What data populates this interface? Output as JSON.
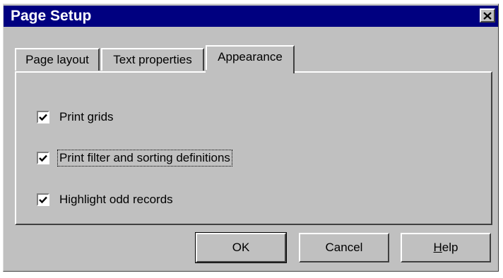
{
  "window": {
    "title": "Page Setup",
    "close_glyph": "✕"
  },
  "tabs": [
    {
      "label": "Page layout",
      "active": false
    },
    {
      "label": "Text properties",
      "active": false
    },
    {
      "label": "Appearance",
      "active": true
    }
  ],
  "options": [
    {
      "label": "Print grids",
      "checked": true
    },
    {
      "label": "Print filter and sorting definitions",
      "checked": true
    },
    {
      "label": "Highlight odd records",
      "checked": true
    }
  ],
  "buttons": {
    "ok": "OK",
    "cancel": "Cancel",
    "help_prefix": "H",
    "help_rest": "elp"
  },
  "colors": {
    "title_bar": "#000080",
    "face": "#c0c0c0"
  }
}
